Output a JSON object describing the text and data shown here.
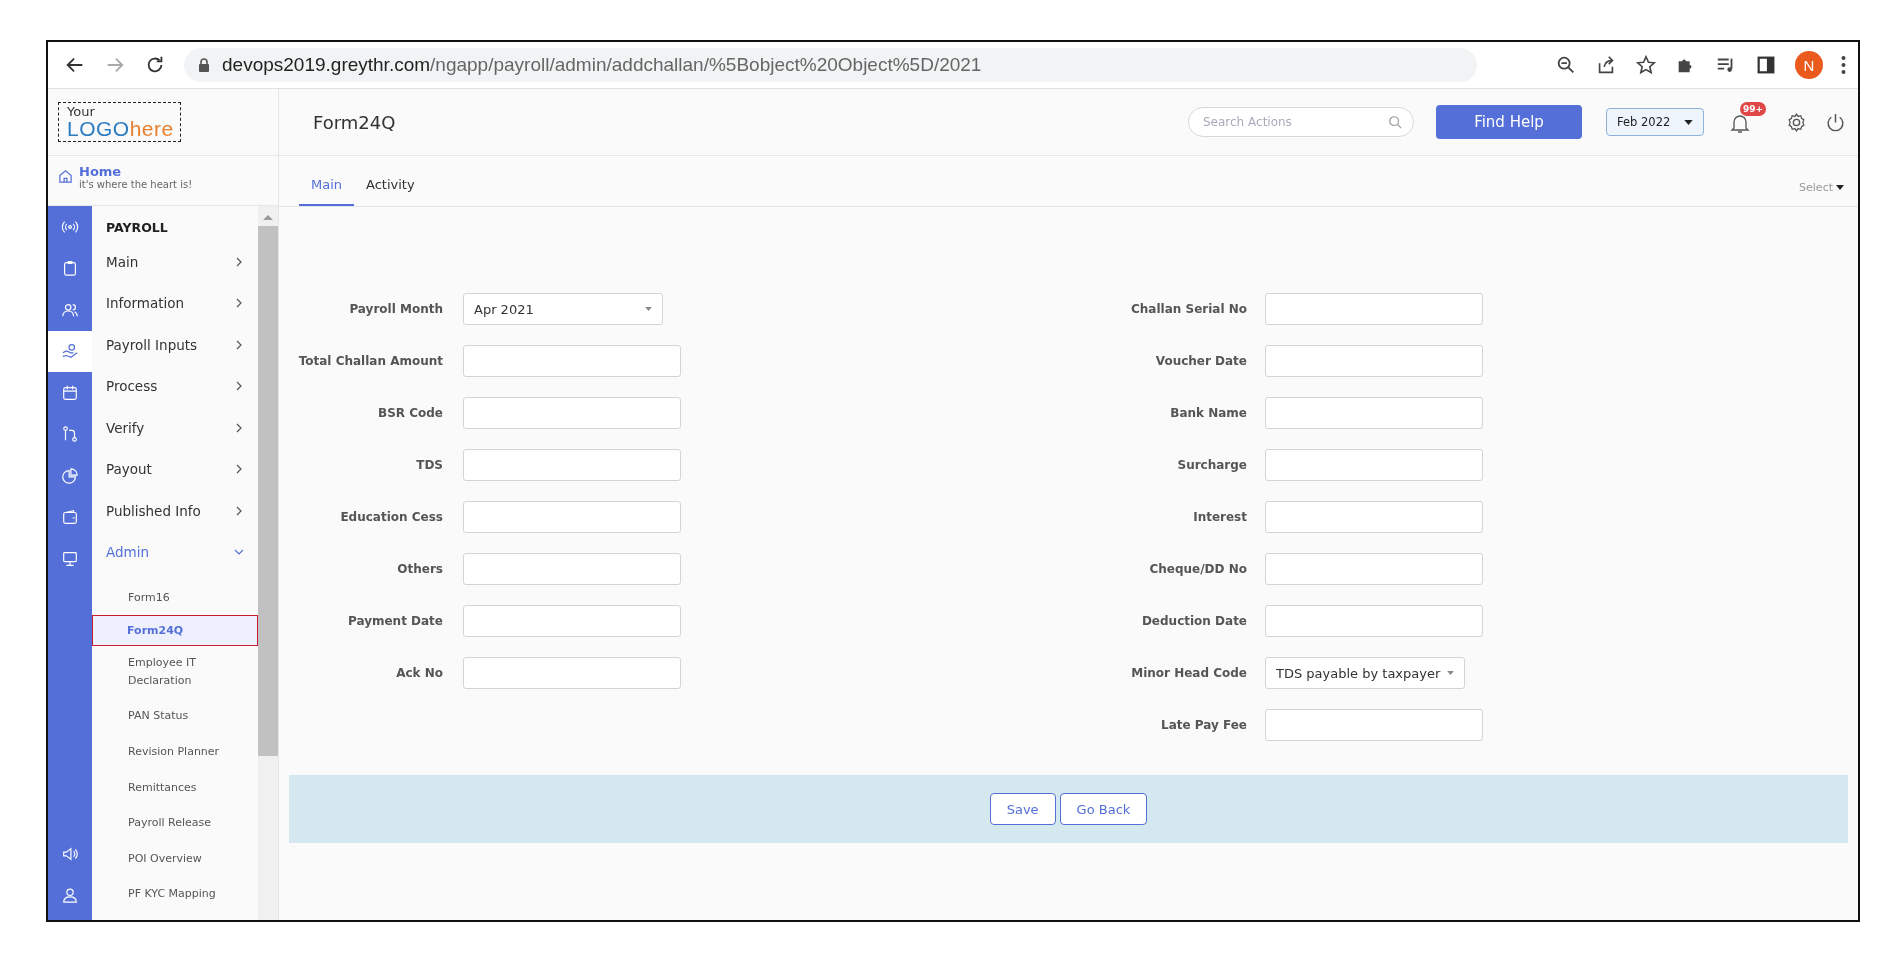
{
  "browser": {
    "url_host": "devops2019.greythr.com",
    "url_path": "/ngapp/payroll/admin/addchallan/%5Bobject%20Object%5D/2021",
    "profile_initial": "N"
  },
  "logo": {
    "line_1": "Your",
    "logo_main": "LOGO",
    "logo_tail": "here"
  },
  "home": {
    "title": "Home",
    "subtitle": "it's where the heart is!"
  },
  "header": {
    "page_title": "Form24Q",
    "search": {
      "placeholder": "Search Actions"
    },
    "help_button": "Find Help",
    "period": "Feb 2022",
    "notification_badge": "99+"
  },
  "rail": [
    {
      "kind": "broadcast",
      "selected": false
    },
    {
      "kind": "clipboard",
      "selected": false
    },
    {
      "kind": "people",
      "selected": false
    },
    {
      "kind": "hand",
      "selected": true
    },
    {
      "kind": "calendar",
      "selected": false
    },
    {
      "kind": "flow",
      "selected": false
    },
    {
      "kind": "pie",
      "selected": false
    },
    {
      "kind": "wallet",
      "selected": false
    },
    {
      "kind": "monitor",
      "selected": false
    }
  ],
  "rail_bottom": [
    {
      "kind": "speaker",
      "selected": false
    },
    {
      "kind": "user",
      "selected": false
    }
  ],
  "menu": {
    "heading": "PAYROLL",
    "items": [
      {
        "label": "Main",
        "expanded": false,
        "selected": false
      },
      {
        "label": "Information",
        "expanded": false,
        "selected": false
      },
      {
        "label": "Payroll Inputs",
        "expanded": false,
        "selected": false
      },
      {
        "label": "Process",
        "expanded": false,
        "selected": false
      },
      {
        "label": "Verify",
        "expanded": false,
        "selected": false
      },
      {
        "label": "Payout",
        "expanded": false,
        "selected": false
      },
      {
        "label": "Published Info",
        "expanded": false,
        "selected": false
      },
      {
        "label": "Admin",
        "expanded": true,
        "selected": true,
        "children": [
          {
            "label": "Form16",
            "selected": false
          },
          {
            "label": "Form24Q",
            "selected": true
          },
          {
            "label": "Employee IT Declaration",
            "selected": false
          },
          {
            "label": "PAN Status",
            "selected": false
          },
          {
            "label": "Revision Planner",
            "selected": false
          },
          {
            "label": "Remittances",
            "selected": false
          },
          {
            "label": "Payroll Release",
            "selected": false
          },
          {
            "label": "POI Overview",
            "selected": false
          },
          {
            "label": "PF KYC Mapping",
            "selected": false
          }
        ]
      }
    ]
  },
  "tabs": [
    {
      "label": "Main",
      "selected": true
    },
    {
      "label": "Activity",
      "selected": false
    }
  ],
  "select_menu": "Select",
  "form": {
    "left": [
      {
        "label": "Payroll Month",
        "kind": "select",
        "value": "Apr 2021"
      },
      {
        "label": "Total Challan Amount",
        "kind": "input"
      },
      {
        "label": "BSR Code",
        "kind": "input"
      },
      {
        "label": "TDS",
        "kind": "input"
      },
      {
        "label": "Education Cess",
        "kind": "input"
      },
      {
        "label": "Others",
        "kind": "input"
      },
      {
        "label": "Payment Date",
        "kind": "input"
      },
      {
        "label": "Ack No",
        "kind": "input"
      }
    ],
    "right": [
      {
        "label": "Challan Serial No",
        "kind": "input"
      },
      {
        "label": "Voucher Date",
        "kind": "input"
      },
      {
        "label": "Bank Name",
        "kind": "input"
      },
      {
        "label": "Surcharge",
        "kind": "input"
      },
      {
        "label": "Interest",
        "kind": "input"
      },
      {
        "label": "Cheque/DD No",
        "kind": "input"
      },
      {
        "label": "Deduction Date",
        "kind": "input"
      },
      {
        "label": "Minor Head Code",
        "kind": "select",
        "value": "TDS payable by taxpayer"
      },
      {
        "label": "Late Pay Fee",
        "kind": "input"
      }
    ]
  },
  "actions": [
    "Save",
    "Go Back"
  ]
}
